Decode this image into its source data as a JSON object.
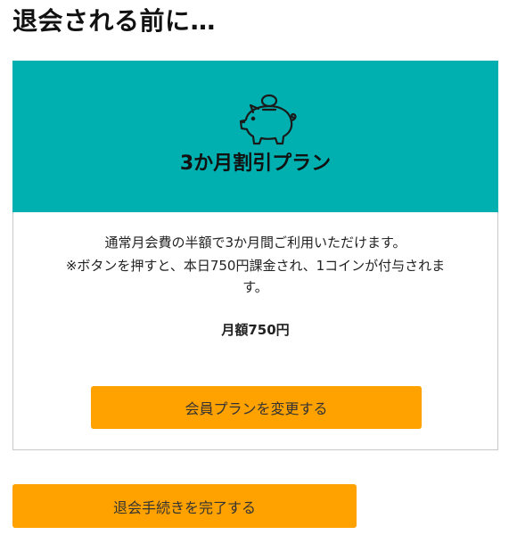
{
  "page": {
    "title": "退会される前に…"
  },
  "plan_card": {
    "icon": "piggy-bank-icon",
    "header_color": "#00afaf",
    "plan_name": "3か月割引プラン",
    "description_line1": "通常月会費の半額で3か月間ご利用いただけます。",
    "description_line2": "※ボタンを押すと、本日750円課金され、1コインが付与されま",
    "description_line3": "す。",
    "price": "月額750円",
    "change_plan_label": "会員プランを変更する"
  },
  "withdraw": {
    "complete_label": "退会手続きを完了する"
  },
  "colors": {
    "accent": "#ffa200",
    "teal": "#00afaf"
  }
}
